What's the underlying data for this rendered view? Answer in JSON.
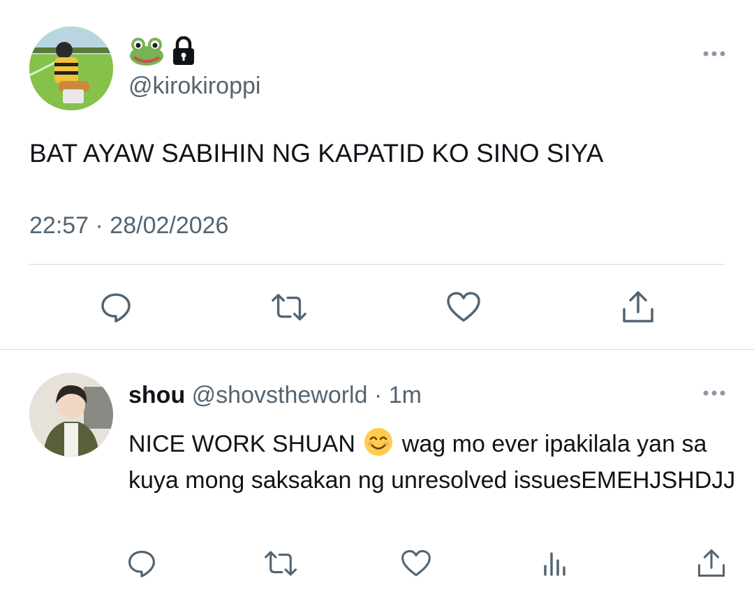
{
  "main_tweet": {
    "handle": "@kirokiroppi",
    "text": "BAT AYAW SABIHIN NG KAPATID KO SINO SIYA",
    "timestamp": "22:57 · 28/02/2026",
    "badges": [
      "frog-emoji",
      "lock-icon"
    ]
  },
  "reply": {
    "display_name": "shou",
    "handle_time": "@shovstheworld · 1m",
    "text_before_emoji": "NICE WORK SHUAN ",
    "emoji": "smiling-face-emoji",
    "text_after_emoji": " wag mo ever ipakilala yan sa kuya mong saksakan ng unresolved issuesEMEHJSHDJJ"
  },
  "colors": {
    "text_primary": "#0f1419",
    "text_secondary": "#536471",
    "divider": "#cfd9de"
  },
  "icons": {
    "main_actions": [
      "reply-icon",
      "retweet-icon",
      "like-icon",
      "share-icon"
    ],
    "reply_actions": [
      "reply-icon",
      "retweet-icon",
      "like-icon",
      "views-icon",
      "share-icon"
    ]
  }
}
